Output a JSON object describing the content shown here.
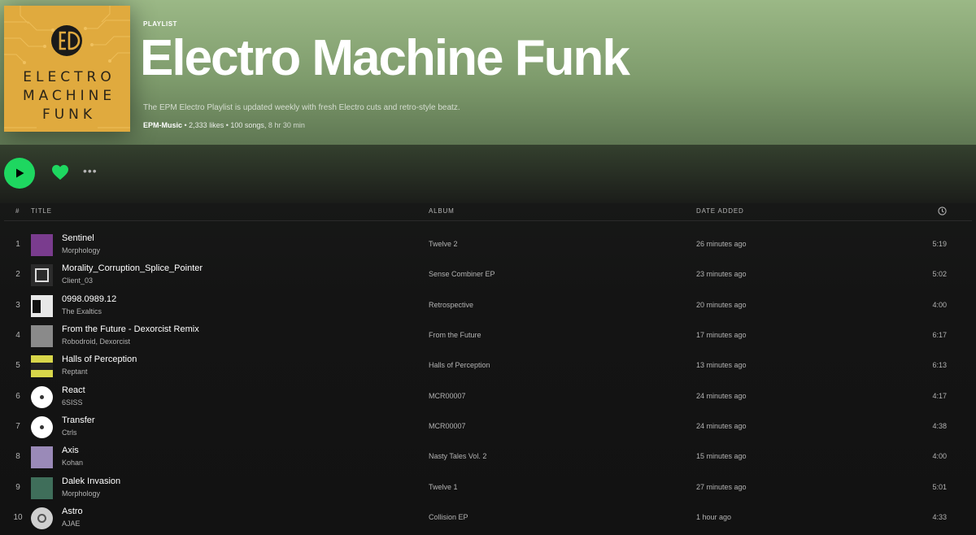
{
  "playlist": {
    "type_label": "PLAYLIST",
    "title": "Electro Machine Funk",
    "description": "The EPM Electro Playlist is updated weekly with fresh Electro cuts and retro-style beatz.",
    "owner": "EPM-Music",
    "stats": " • 2,333 likes • 100 songs,",
    "duration": " 8 hr 30 min",
    "cover_lines": [
      "ELECTRO",
      "MACHINE",
      "FUNK"
    ],
    "cover_color": "#e0aa3e"
  },
  "actions": {
    "play_icon": "play-icon",
    "heart_icon": "heart-icon",
    "more_label": "•••",
    "accent": "#1ed760"
  },
  "table": {
    "headers": {
      "num": "#",
      "title": "TITLE",
      "album": "ALBUM",
      "date": "DATE ADDED",
      "duration_icon": "clock-icon"
    },
    "rows": [
      {
        "num": "1",
        "title": "Sentinel",
        "artist": "Morphology",
        "album": "Twelve 2",
        "date": "26 minutes ago",
        "duration": "5:19",
        "thumb": "#7a3c8e"
      },
      {
        "num": "2",
        "title": "Morality_Corruption_Splice_Pointer",
        "artist": "Client_03",
        "album": "Sense Combiner EP",
        "date": "23 minutes ago",
        "duration": "5:02",
        "thumb": "#2b2b2b"
      },
      {
        "num": "3",
        "title": "0998.0989.12",
        "artist": "The Exaltics",
        "album": "Retrospective",
        "date": "20 minutes ago",
        "duration": "4:00",
        "thumb": "#e8e8e8"
      },
      {
        "num": "4",
        "title": "From the Future - Dexorcist Remix",
        "artist": "Robodroid, Dexorcist",
        "album": "From the Future",
        "date": "17 minutes ago",
        "duration": "6:17",
        "thumb": "#8a8a8a"
      },
      {
        "num": "5",
        "title": "Halls of Perception",
        "artist": "Reptant",
        "album": "Halls of Perception",
        "date": "13 minutes ago",
        "duration": "6:13",
        "thumb": "#d8d64a"
      },
      {
        "num": "6",
        "title": "React",
        "artist": "6SISS",
        "album": "MCR00007",
        "date": "24 minutes ago",
        "duration": "4:17",
        "thumb": "#f4f4f4"
      },
      {
        "num": "7",
        "title": "Transfer",
        "artist": "Ctrls",
        "album": "MCR00007",
        "date": "24 minutes ago",
        "duration": "4:38",
        "thumb": "#f4f4f4"
      },
      {
        "num": "8",
        "title": "Axis",
        "artist": "Kohan",
        "album": "Nasty Tales Vol. 2",
        "date": "15 minutes ago",
        "duration": "4:00",
        "thumb": "#9a8ab8"
      },
      {
        "num": "9",
        "title": "Dalek Invasion",
        "artist": "Morphology",
        "album": "Twelve 1",
        "date": "27 minutes ago",
        "duration": "5:01",
        "thumb": "#3f6e5a"
      },
      {
        "num": "10",
        "title": "Astro",
        "artist": "AJAE",
        "album": "Collision EP",
        "date": "1 hour ago",
        "duration": "4:33",
        "thumb": "#cfcfcf"
      }
    ]
  }
}
